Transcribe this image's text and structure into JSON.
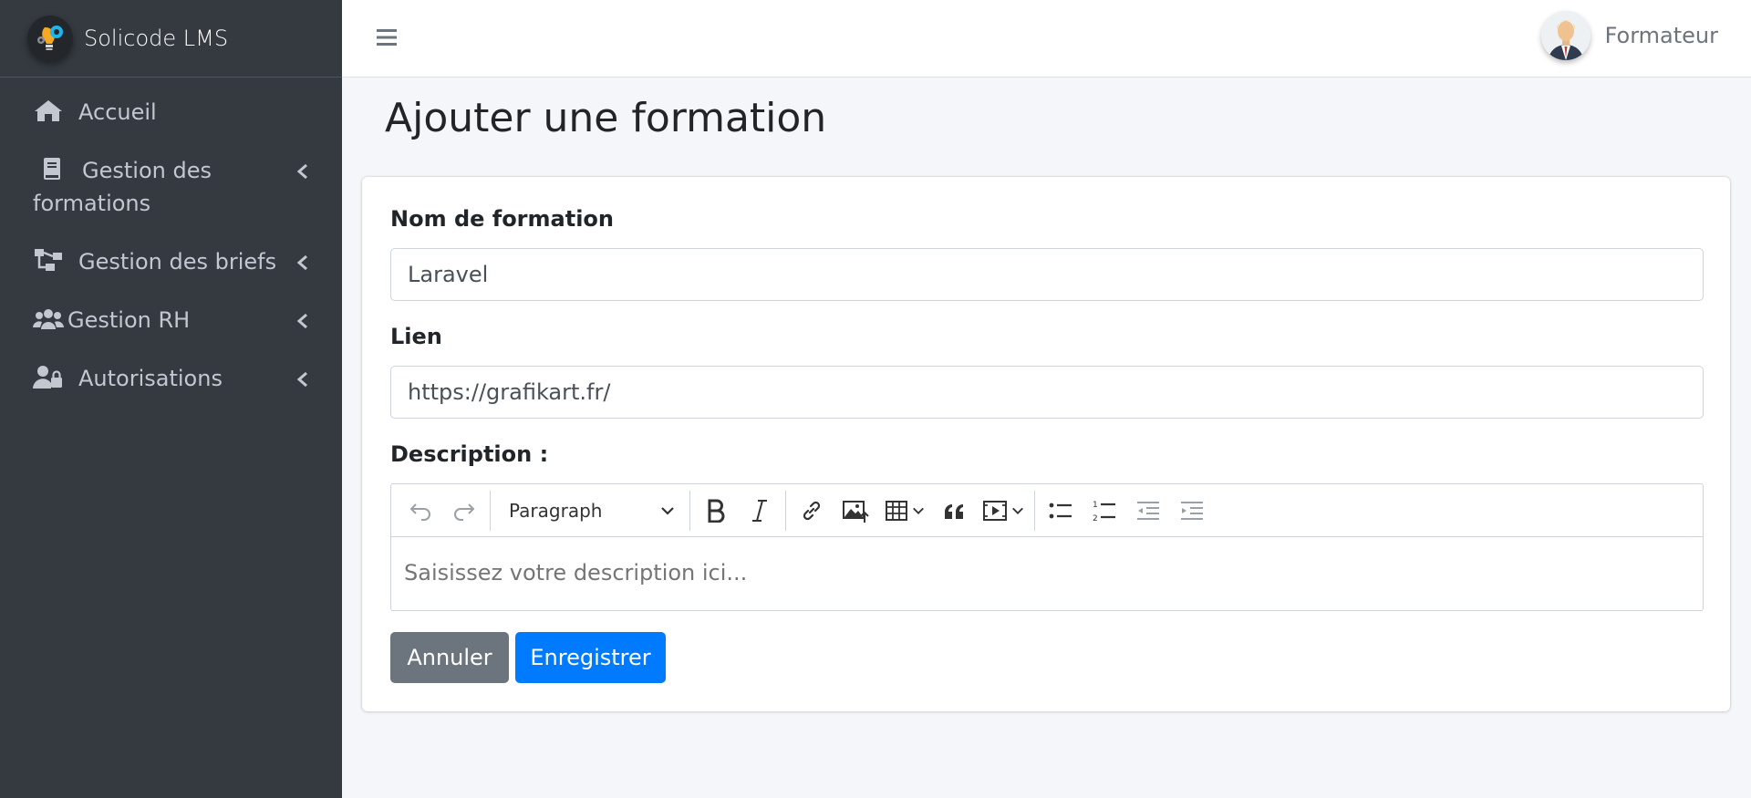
{
  "brand": {
    "name": "Solicode LMS",
    "logo_icon": "lightbulb-gear-logo"
  },
  "sidebar": {
    "items": [
      {
        "label": "Accueil",
        "icon": "home-icon"
      },
      {
        "label_line1": "Gestion des",
        "label_line2": "formations",
        "icon": "book-icon"
      },
      {
        "label": "Gestion des briefs",
        "icon": "sitemap-icon"
      },
      {
        "label": "Gestion RH",
        "icon": "users-icon"
      },
      {
        "label": "Autorisations",
        "icon": "user-lock-icon"
      }
    ]
  },
  "topbar": {
    "menu_icon": "hamburger-icon",
    "user_name": "Formateur"
  },
  "page": {
    "title": "Ajouter une formation"
  },
  "form": {
    "name_label": "Nom de formation",
    "name_value": "Laravel",
    "link_label": "Lien",
    "link_value": "https://grafikart.fr/",
    "description_label": "Description :",
    "paragraph_select": "Paragraph",
    "description_placeholder": "Saisissez votre description ici...",
    "cancel_label": "Annuler",
    "save_label": "Enregistrer"
  },
  "colors": {
    "sidebar_bg": "#343a40",
    "content_bg": "#f4f6f9",
    "primary": "#007bff",
    "secondary": "#6c757d"
  }
}
